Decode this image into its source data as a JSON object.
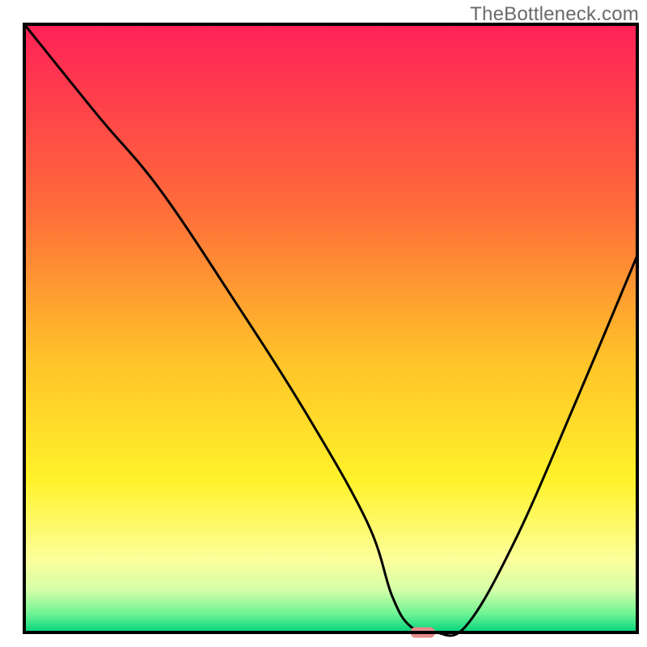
{
  "watermark": "TheBottleneck.com",
  "chart_data": {
    "type": "line",
    "title": "",
    "xlabel": "",
    "ylabel": "",
    "xlim": [
      0,
      100
    ],
    "ylim": [
      0,
      100
    ],
    "x": [
      0,
      12,
      22,
      34,
      46,
      56,
      60,
      63,
      67,
      72,
      80,
      90,
      100
    ],
    "values": [
      100,
      85,
      73,
      55,
      36,
      18,
      6,
      1,
      0,
      1,
      15,
      38,
      62
    ],
    "marker": {
      "x": 65,
      "y": 0,
      "width_pct": 4,
      "color": "#e58a8a"
    },
    "gradient_stops": [
      {
        "pct": 0,
        "color": "#ff2157"
      },
      {
        "pct": 30,
        "color": "#ff6b3a"
      },
      {
        "pct": 55,
        "color": "#ffc229"
      },
      {
        "pct": 75,
        "color": "#fff22a"
      },
      {
        "pct": 88,
        "color": "#fcff9b"
      },
      {
        "pct": 93,
        "color": "#d5ffa8"
      },
      {
        "pct": 97,
        "color": "#6cf394"
      },
      {
        "pct": 100,
        "color": "#00d37b"
      }
    ],
    "frame_color": "#000000",
    "line_color": "#000000"
  }
}
